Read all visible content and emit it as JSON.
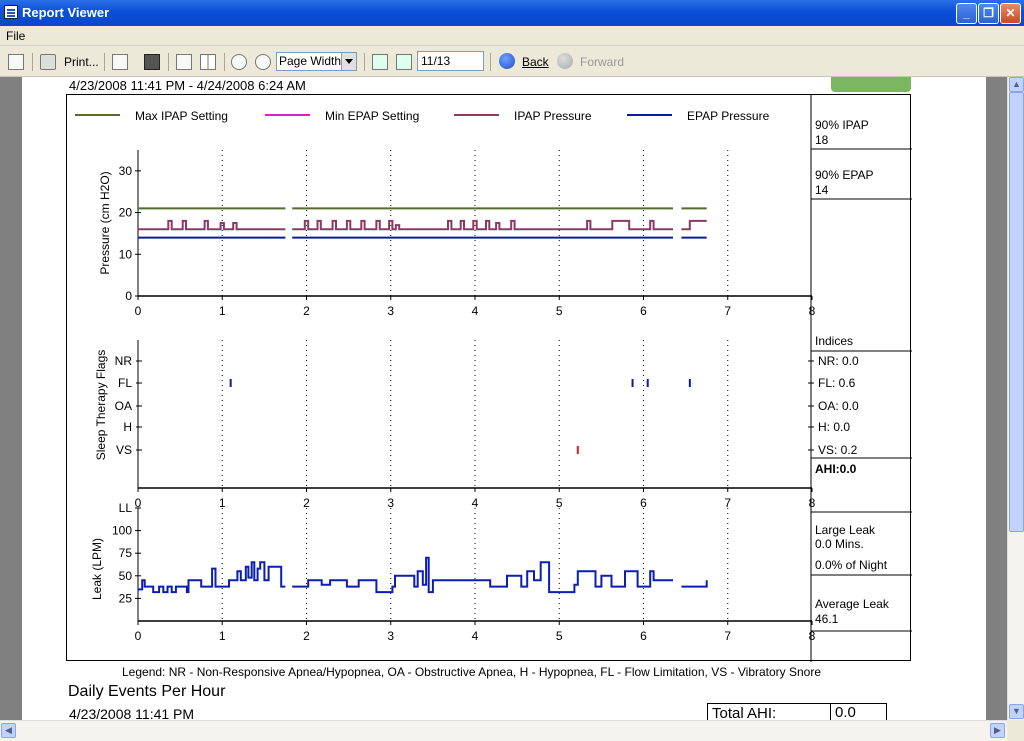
{
  "window": {
    "title": "Report Viewer",
    "minimize": "_",
    "maximize": "❐",
    "close": "✕"
  },
  "menu": {
    "file": "File"
  },
  "toolbar": {
    "print": "Print...",
    "zoom": "Page Width",
    "page": "11/13",
    "back": "Back",
    "forward": "Forward"
  },
  "report": {
    "date_range": "4/23/2008 11:41 PM - 4/24/2008 6:24 AM",
    "legend": {
      "max_ipap": "Max IPAP Setting",
      "min_epap": "Min EPAP Setting",
      "ipap_pressure": "IPAP Pressure",
      "epap_pressure": "EPAP Pressure"
    },
    "side": {
      "ipap90_label": "90% IPAP",
      "ipap90_value": "18",
      "epap90_label": "90% EPAP",
      "epap90_value": "14",
      "indices_label": "Indices",
      "nr": "NR: 0.0",
      "fl": "FL: 0.6",
      "oa": "OA: 0.0",
      "h": "H: 0.0",
      "vs": "VS: 0.2",
      "ahi": "AHI:0.0",
      "large_leak_label1": "Large Leak",
      "large_leak_mins": "0.0 Mins.",
      "large_leak_pct": "0.0% of Night",
      "avg_leak_label": "Average Leak",
      "avg_leak_value": "46.1"
    },
    "legend_note": "Legend: NR - Non-Responsive Apnea/Hypopnea, OA - Obstructive Apnea, H - Hypopnea, FL - Flow Limitation, VS - Vibratory Snore",
    "daily_title": "Daily Events Per Hour",
    "daily_date": "4/23/2008 11:41 PM",
    "total_ahi_label": "Total AHI:",
    "total_ahi_value": "0.0"
  },
  "colors": {
    "max_ipap": "#556b2f",
    "min_epap": "#e020c0",
    "ipap": "#8b3a62",
    "epap": "#0a1e96",
    "leak": "#0a1eb4",
    "vs_flag": "#d02020"
  },
  "chart_data": [
    {
      "type": "line",
      "title": "",
      "xlabel": "",
      "ylabel": "Pressure (cm H2O)",
      "xlim": [
        0,
        8
      ],
      "ylim": [
        0,
        35
      ],
      "x_ticks": [
        0,
        1,
        2,
        3,
        4,
        5,
        6,
        7,
        8
      ],
      "y_ticks": [
        0,
        10,
        20,
        30
      ],
      "series": [
        {
          "name": "Max IPAP Setting",
          "segments": [
            [
              [
                0,
                21
              ],
              [
                1.75,
                21
              ]
            ],
            [
              [
                1.83,
                21
              ],
              [
                6.35,
                21
              ]
            ],
            [
              [
                6.45,
                21
              ],
              [
                6.75,
                21
              ]
            ]
          ]
        },
        {
          "name": "Min EPAP Setting",
          "segments": []
        },
        {
          "name": "IPAP Pressure",
          "segments": [
            [
              [
                0,
                16
              ],
              [
                0.33,
                16
              ],
              [
                0.36,
                18
              ],
              [
                0.4,
                16
              ],
              [
                0.5,
                16
              ],
              [
                0.53,
                18
              ],
              [
                0.57,
                16
              ],
              [
                0.76,
                16
              ],
              [
                0.79,
                18
              ],
              [
                0.83,
                16
              ],
              [
                0.95,
                16
              ],
              [
                0.98,
                17.5
              ],
              [
                1.02,
                16
              ],
              [
                1.1,
                16
              ],
              [
                1.13,
                17.5
              ],
              [
                1.17,
                16
              ],
              [
                1.75,
                16
              ]
            ],
            [
              [
                1.83,
                16
              ],
              [
                1.95,
                16
              ],
              [
                1.98,
                18
              ],
              [
                2.02,
                16
              ],
              [
                2.1,
                16
              ],
              [
                2.13,
                18
              ],
              [
                2.17,
                16
              ],
              [
                2.28,
                16
              ],
              [
                2.31,
                18
              ],
              [
                2.35,
                16
              ],
              [
                2.45,
                16
              ],
              [
                2.48,
                18
              ],
              [
                2.52,
                16
              ],
              [
                2.62,
                16
              ],
              [
                2.65,
                18
              ],
              [
                2.69,
                16
              ],
              [
                2.8,
                16
              ],
              [
                2.83,
                18
              ],
              [
                2.87,
                16
              ],
              [
                2.95,
                16
              ],
              [
                2.98,
                18
              ],
              [
                3.02,
                16
              ],
              [
                3.06,
                17
              ],
              [
                3.1,
                16
              ],
              [
                3.65,
                16
              ],
              [
                3.68,
                18
              ],
              [
                3.72,
                16
              ],
              [
                3.8,
                16
              ],
              [
                3.83,
                18
              ],
              [
                3.87,
                16
              ],
              [
                3.95,
                16
              ],
              [
                3.98,
                18
              ],
              [
                4.02,
                16
              ],
              [
                4.1,
                16
              ],
              [
                4.13,
                18
              ],
              [
                4.17,
                16
              ],
              [
                4.22,
                16
              ],
              [
                4.25,
                17.5
              ],
              [
                4.29,
                16
              ],
              [
                4.4,
                16
              ],
              [
                4.43,
                18
              ],
              [
                4.47,
                16
              ],
              [
                5.3,
                16
              ],
              [
                5.33,
                18
              ],
              [
                5.37,
                16
              ],
              [
                5.6,
                16
              ],
              [
                5.63,
                18
              ],
              [
                5.8,
                18
              ],
              [
                5.83,
                16
              ],
              [
                6.05,
                16
              ],
              [
                6.08,
                18
              ],
              [
                6.12,
                16
              ],
              [
                6.35,
                16
              ]
            ],
            [
              [
                6.45,
                16
              ],
              [
                6.52,
                16
              ],
              [
                6.55,
                18
              ],
              [
                6.75,
                18
              ]
            ]
          ]
        },
        {
          "name": "EPAP Pressure",
          "segments": [
            [
              [
                0,
                14
              ],
              [
                1.75,
                14
              ]
            ],
            [
              [
                1.83,
                14
              ],
              [
                6.35,
                14
              ]
            ],
            [
              [
                6.45,
                14
              ],
              [
                6.75,
                14
              ]
            ]
          ]
        }
      ]
    },
    {
      "type": "scatter",
      "title": "",
      "ylabel": "Sleep Therapy Flags",
      "xlim": [
        0,
        8
      ],
      "x_ticks": [
        0,
        1,
        2,
        3,
        4,
        5,
        6,
        7,
        8
      ],
      "categories": [
        "NR",
        "FL",
        "OA",
        "H",
        "VS"
      ],
      "points": [
        {
          "x": 1.1,
          "category": "FL"
        },
        {
          "x": 5.87,
          "category": "FL"
        },
        {
          "x": 6.05,
          "category": "FL"
        },
        {
          "x": 6.55,
          "category": "FL"
        },
        {
          "x": 5.22,
          "category": "VS"
        }
      ]
    },
    {
      "type": "line",
      "title": "",
      "ylabel": "Leak (LPM)",
      "xlim": [
        0,
        8
      ],
      "ylim": [
        0,
        125
      ],
      "x_ticks": [
        0,
        1,
        2,
        3,
        4,
        5,
        6,
        7,
        8
      ],
      "y_ticks": [
        25,
        50,
        75,
        100
      ],
      "y_tick_labels": [
        "25",
        "50",
        "75",
        "100",
        "LL"
      ],
      "series": [
        {
          "name": "",
          "segments": [
            [
              [
                0,
                35
              ],
              [
                0.05,
                45
              ],
              [
                0.08,
                38
              ],
              [
                0.15,
                38
              ],
              [
                0.18,
                32
              ],
              [
                0.25,
                38
              ],
              [
                0.3,
                32
              ],
              [
                0.35,
                38
              ],
              [
                0.4,
                32
              ],
              [
                0.45,
                38
              ],
              [
                0.55,
                38
              ],
              [
                0.58,
                32
              ],
              [
                0.6,
                45
              ],
              [
                0.72,
                45
              ],
              [
                0.75,
                38
              ],
              [
                0.85,
                38
              ],
              [
                0.88,
                58
              ],
              [
                0.92,
                38
              ],
              [
                1.05,
                38
              ],
              [
                1.08,
                45
              ],
              [
                1.15,
                45
              ],
              [
                1.18,
                55
              ],
              [
                1.22,
                45
              ],
              [
                1.28,
                60
              ],
              [
                1.31,
                48
              ],
              [
                1.35,
                65
              ],
              [
                1.38,
                45
              ],
              [
                1.42,
                58
              ],
              [
                1.45,
                65
              ],
              [
                1.5,
                45
              ],
              [
                1.55,
                60
              ],
              [
                1.65,
                60
              ],
              [
                1.7,
                38
              ],
              [
                1.75,
                38
              ]
            ],
            [
              [
                1.83,
                38
              ],
              [
                2.0,
                38
              ],
              [
                2.02,
                45
              ],
              [
                2.15,
                45
              ],
              [
                2.18,
                40
              ],
              [
                2.25,
                40
              ],
              [
                2.28,
                45
              ],
              [
                2.45,
                45
              ],
              [
                2.48,
                38
              ],
              [
                2.6,
                38
              ],
              [
                2.62,
                45
              ],
              [
                2.8,
                45
              ],
              [
                2.83,
                32
              ],
              [
                3.0,
                32
              ],
              [
                3.02,
                38
              ],
              [
                3.05,
                50
              ],
              [
                3.25,
                50
              ],
              [
                3.28,
                38
              ],
              [
                3.32,
                55
              ],
              [
                3.38,
                40
              ],
              [
                3.42,
                70
              ],
              [
                3.45,
                32
              ],
              [
                3.5,
                45
              ],
              [
                4.15,
                45
              ],
              [
                4.18,
                38
              ],
              [
                4.35,
                38
              ],
              [
                4.38,
                50
              ],
              [
                4.52,
                50
              ],
              [
                4.55,
                38
              ],
              [
                4.62,
                55
              ],
              [
                4.7,
                45
              ],
              [
                4.78,
                65
              ],
              [
                4.85,
                65
              ],
              [
                4.88,
                32
              ],
              [
                5.15,
                32
              ],
              [
                5.18,
                40
              ],
              [
                5.22,
                55
              ],
              [
                5.4,
                55
              ],
              [
                5.43,
                38
              ],
              [
                5.5,
                50
              ],
              [
                5.58,
                50
              ],
              [
                5.62,
                38
              ],
              [
                5.75,
                38
              ],
              [
                5.78,
                55
              ],
              [
                5.9,
                55
              ],
              [
                5.93,
                38
              ],
              [
                6.05,
                38
              ],
              [
                6.08,
                55
              ],
              [
                6.12,
                45
              ],
              [
                6.35,
                45
              ]
            ],
            [
              [
                6.45,
                38
              ],
              [
                6.72,
                38
              ],
              [
                6.75,
                45
              ]
            ]
          ]
        }
      ]
    }
  ]
}
